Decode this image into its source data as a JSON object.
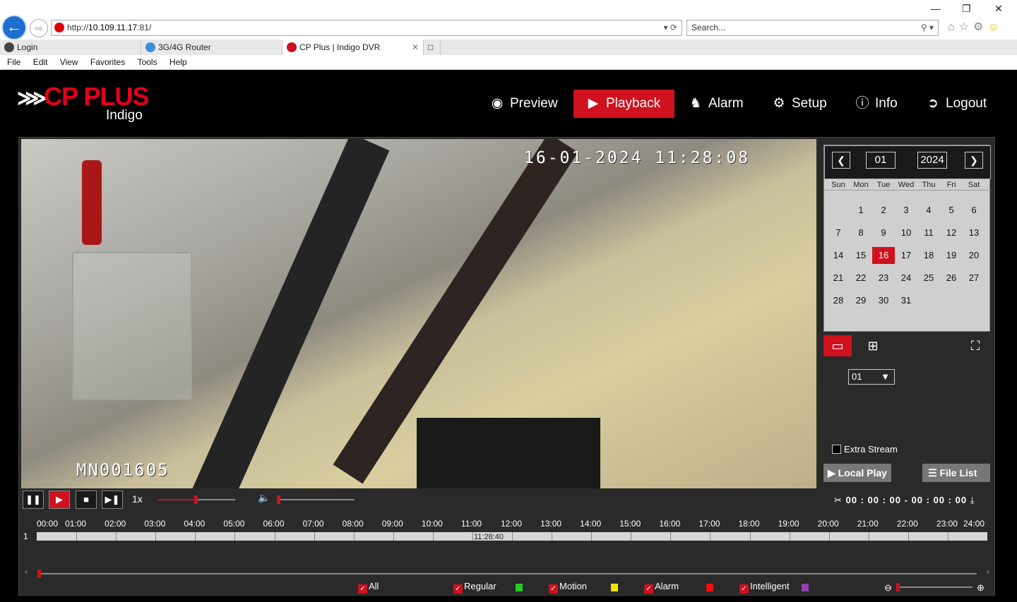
{
  "browser": {
    "url_prefix": "http://",
    "url_host": "10.109.11.17",
    "url_port": ":81/",
    "search_placeholder": "Search...",
    "tabs": [
      {
        "label": "Login"
      },
      {
        "label": "3G/4G Router"
      },
      {
        "label": "CP Plus | Indigo DVR"
      }
    ],
    "menu": [
      "File",
      "Edit",
      "View",
      "Favorites",
      "Tools",
      "Help"
    ]
  },
  "brand": {
    "name": "CP PLUS",
    "sub": "Indigo",
    "color": "#e3001b"
  },
  "nav": [
    {
      "label": "Preview",
      "icon": "eye-icon"
    },
    {
      "label": "Playback",
      "icon": "play-circle-icon",
      "active": true
    },
    {
      "label": "Alarm",
      "icon": "bell-icon"
    },
    {
      "label": "Setup",
      "icon": "gear-icon"
    },
    {
      "label": "Info",
      "icon": "info-icon"
    },
    {
      "label": "Logout",
      "icon": "logout-icon"
    }
  ],
  "video": {
    "timestamp": "16-01-2024  11:28:08",
    "camera_id": "MN001605"
  },
  "calendar": {
    "month": "01",
    "year": "2024",
    "weekdays": [
      "Sun",
      "Mon",
      "Tue",
      "Wed",
      "Thu",
      "Fri",
      "Sat"
    ],
    "weeks": [
      [
        "",
        "1",
        "2",
        "3",
        "4",
        "5",
        "6"
      ],
      [
        "7",
        "8",
        "9",
        "10",
        "11",
        "12",
        "13"
      ],
      [
        "14",
        "15",
        "16",
        "17",
        "18",
        "19",
        "20"
      ],
      [
        "21",
        "22",
        "23",
        "24",
        "25",
        "26",
        "27"
      ],
      [
        "28",
        "29",
        "30",
        "31",
        "",
        "",
        ""
      ]
    ],
    "selected_day": "16"
  },
  "channel": {
    "selected": "01"
  },
  "extra_stream": {
    "label": "Extra Stream",
    "checked": false
  },
  "buttons": {
    "local_play": "Local Play",
    "file_list": "File List"
  },
  "playback": {
    "speed": "1x",
    "clip_range": "00 : 00 : 00 - 00 : 00 : 00"
  },
  "timeline": {
    "hours": [
      "00:00",
      "01:00",
      "02:00",
      "03:00",
      "04:00",
      "05:00",
      "06:00",
      "07:00",
      "08:00",
      "09:00",
      "10:00",
      "11:00",
      "12:00",
      "13:00",
      "14:00",
      "15:00",
      "16:00",
      "17:00",
      "18:00",
      "19:00",
      "20:00",
      "21:00",
      "22:00",
      "23:00",
      "24:00"
    ],
    "channel_num": "1",
    "cursor_time": "11:28:40"
  },
  "legend": [
    {
      "label": "All",
      "color": ""
    },
    {
      "label": "Regular",
      "color": "#22cc22"
    },
    {
      "label": "Motion",
      "color": "#f2e600"
    },
    {
      "label": "Alarm",
      "color": "#ee1111"
    },
    {
      "label": "Intelligent",
      "color": "#9b3fb0"
    }
  ]
}
